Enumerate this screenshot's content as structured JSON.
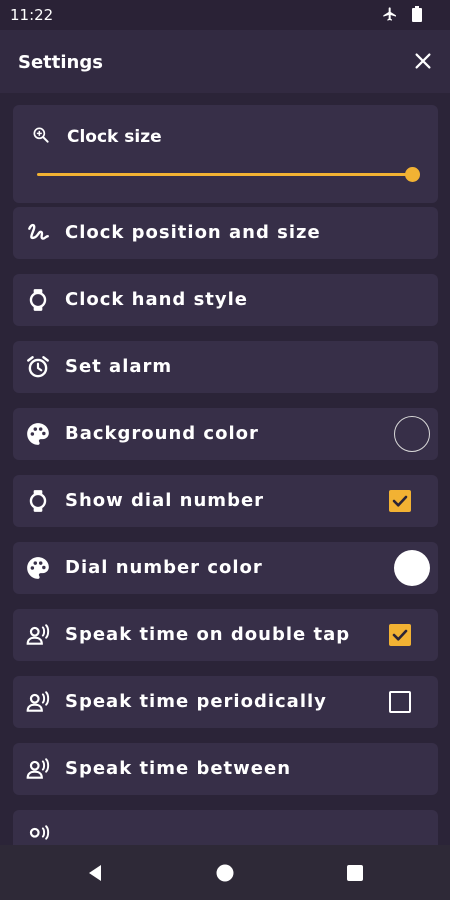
{
  "status": {
    "time": "11:22",
    "icons": [
      "airplane-icon",
      "battery-icon"
    ]
  },
  "header": {
    "title": "Settings",
    "close_icon": "close-icon"
  },
  "clock_size": {
    "label": "Clock size",
    "icon": "zoom-in-icon",
    "slider_fraction": 1.0,
    "accent": "#f2b233"
  },
  "rows": [
    {
      "label": "Clock position and size",
      "icon": "gesture-icon",
      "control": "none"
    },
    {
      "label": "Clock hand style",
      "icon": "watch-icon",
      "control": "none"
    },
    {
      "label": "Set alarm",
      "icon": "alarm-icon",
      "control": "none"
    },
    {
      "label": "Background color",
      "icon": "palette-icon",
      "control": "color",
      "color": "#372f48"
    },
    {
      "label": "Show dial number",
      "icon": "watch-icon",
      "control": "checkbox",
      "checked": true
    },
    {
      "label": "Dial number color",
      "icon": "palette-icon",
      "control": "color",
      "color": "#ffffff"
    },
    {
      "label": "Speak time on double tap",
      "icon": "voice-icon",
      "control": "checkbox",
      "checked": true
    },
    {
      "label": "Speak time periodically",
      "icon": "voice-icon",
      "control": "checkbox",
      "checked": false
    },
    {
      "label": "Speak time between",
      "icon": "voice-icon",
      "control": "none"
    }
  ],
  "nav": [
    "back-icon",
    "home-icon",
    "recents-icon"
  ]
}
